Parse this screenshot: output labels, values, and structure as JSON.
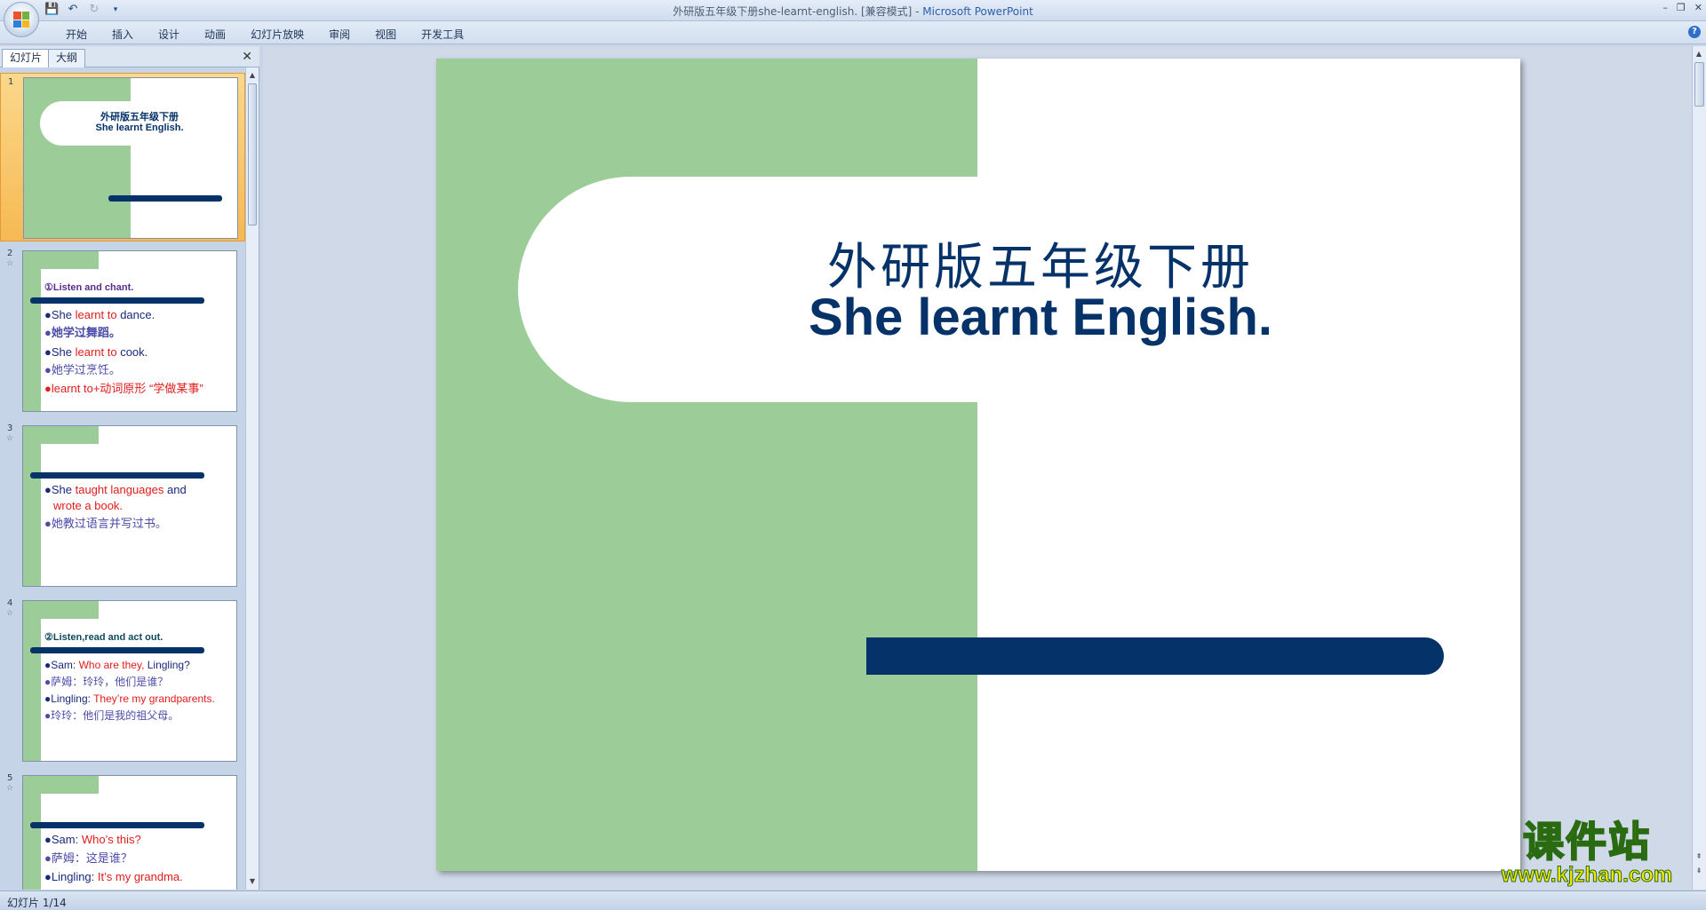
{
  "window": {
    "doc_title": "外研版五年级下册she-learnt-english. [兼容模式]",
    "separator": " - ",
    "app_name": "Microsoft PowerPoint",
    "min": "–",
    "restore": "❐",
    "close": "✕"
  },
  "ribbon": {
    "tabs": [
      "开始",
      "插入",
      "设计",
      "动画",
      "幻灯片放映",
      "审阅",
      "视图",
      "开发工具"
    ],
    "help": "?"
  },
  "pane": {
    "tab_slides": "幻灯片",
    "tab_outline": "大纲",
    "close": "✕"
  },
  "thumbnails": [
    {
      "num": "1",
      "title_cn": "外研版五年级下册",
      "title_en": "She learnt English."
    },
    {
      "num": "2",
      "star": "☆",
      "heading": "①Listen and chant.",
      "lines": [
        [
          "●She ",
          "learnt to",
          " dance."
        ],
        [
          "●她学过舞蹈。"
        ],
        [
          "●She ",
          "learnt to",
          " cook."
        ],
        [
          "●她学过烹饪。"
        ],
        [
          "●learnt to+动词原形 “学做某事”"
        ]
      ]
    },
    {
      "num": "3",
      "star": "☆",
      "lines": [
        [
          "●She ",
          "taught languages",
          " and"
        ],
        [
          "wrote a book."
        ],
        [
          "●她教过语言并写过书。"
        ]
      ]
    },
    {
      "num": "4",
      "star": "☆",
      "heading": "②Listen,read and act out.",
      "lines": [
        [
          "●Sam: ",
          "Who are they,",
          " Lingling?"
        ],
        [
          "●萨姆：玲玲，他们是谁？"
        ],
        [
          "●Lingling: ",
          "They’re my grandparents."
        ],
        [
          "●玲玲：他们是我的祖父母。"
        ]
      ]
    },
    {
      "num": "5",
      "star": "☆",
      "lines": [
        [
          "●Sam: ",
          "Who’s this?"
        ],
        [
          "●萨姆：这是谁？"
        ],
        [
          "●Lingling: ",
          "It’s my grandma."
        ]
      ]
    }
  ],
  "slide": {
    "title_cn": "外研版五年级下册",
    "title_en": "She learnt English."
  },
  "watermark": {
    "cn": "课件站",
    "url": "www.kjzhan.com"
  },
  "status": {
    "slide_counter": "幻灯片 1/14"
  },
  "colors": {
    "green": "#9ccd99",
    "navy": "#06326a",
    "red": "#e31b1b"
  }
}
